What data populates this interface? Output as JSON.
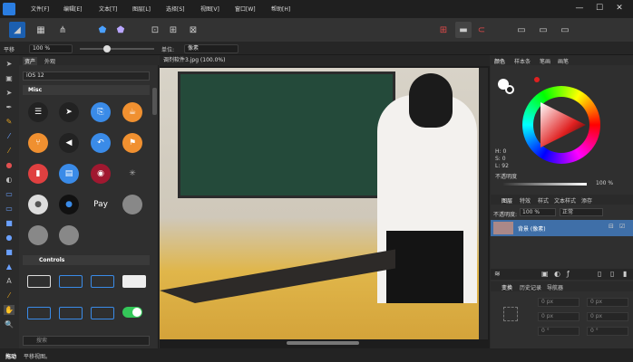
{
  "menu": [
    "文件[F]",
    "编辑[E]",
    "文本[T]",
    "图层[L]",
    "选择[S]",
    "视图[V]",
    "窗口[W]",
    "帮助[H]"
  ],
  "window": {
    "minimize": "—",
    "maximize": "☐",
    "close": "✕"
  },
  "context": {
    "tool_label": "平移",
    "zoom": "100 %",
    "unit_label": "单位:",
    "unit_value": "像素"
  },
  "left_panel": {
    "tabs": [
      "资产",
      "外观"
    ],
    "preset": "iOS 12",
    "section_misc": "Misc",
    "section_controls": "Controls",
    "search_placeholder": "搜索"
  },
  "document_tab": "调剂软件3.jpg (100.0%)",
  "right_top": {
    "tabs": [
      "颜色",
      "样本条",
      "笔画",
      "画笔"
    ],
    "h": "H: 0",
    "s": "S: 0",
    "l": "L: 92",
    "opacity_label": "不透明度",
    "opacity_value": "100 %"
  },
  "layers": {
    "tabs": [
      "图层",
      "特效",
      "样式",
      "文本样式",
      "添存"
    ],
    "opacity_label": "不透明度:",
    "opacity_value": "100 %",
    "blend": "正常",
    "layer_name": "背景 (像素)"
  },
  "transform": {
    "tabs": [
      "变换",
      "历史记录",
      "导航器"
    ],
    "fields": [
      "0 px",
      "0 px",
      "0 px",
      "0 px",
      "0 °",
      "0 °"
    ]
  },
  "status": {
    "tool": "拖动",
    "hint": "平移视图。"
  },
  "colors": {
    "accent": "#2a7de1",
    "selected_layer": "#3f6fa8"
  }
}
